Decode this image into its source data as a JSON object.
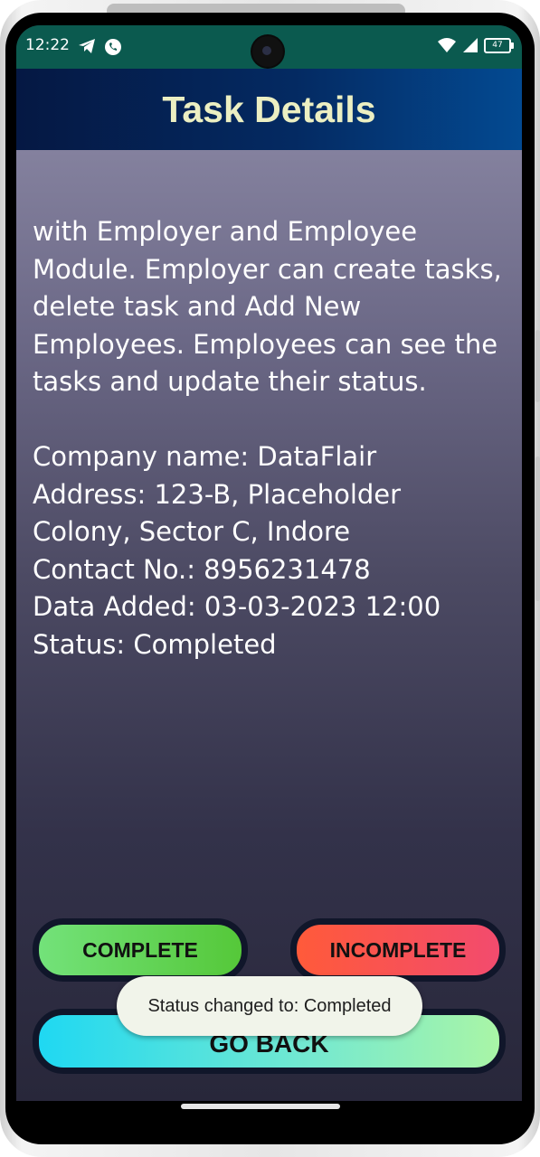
{
  "status_bar": {
    "time": "12:22",
    "left_icons": [
      "telegram-icon",
      "whatsapp-icon"
    ],
    "right_icons": [
      "wifi-icon",
      "signal-icon"
    ],
    "battery": "47"
  },
  "app_bar": {
    "title": "Task Details"
  },
  "details": {
    "text": "with Employer and Employee Module. Employer can create tasks, delete task and Add New Employees. Employees can see the tasks and update their status.\n\nCompany name: DataFlair\nAddress: 123-B, Placeholder Colony, Sector C, Indore\nContact No.: 8956231478\nData Added: 03-03-2023 12:00\nStatus: Completed"
  },
  "buttons": {
    "complete": "COMPLETE",
    "incomplete": "INCOMPLETE",
    "go_back": "GO BACK"
  },
  "toast": {
    "message": "Status changed to: Completed"
  },
  "colors": {
    "status_bar": "#0b5a4f",
    "title": "#ecefc2",
    "complete": "#5fd54a",
    "incomplete": "#f8524e",
    "go_back": "#4fe3de"
  }
}
